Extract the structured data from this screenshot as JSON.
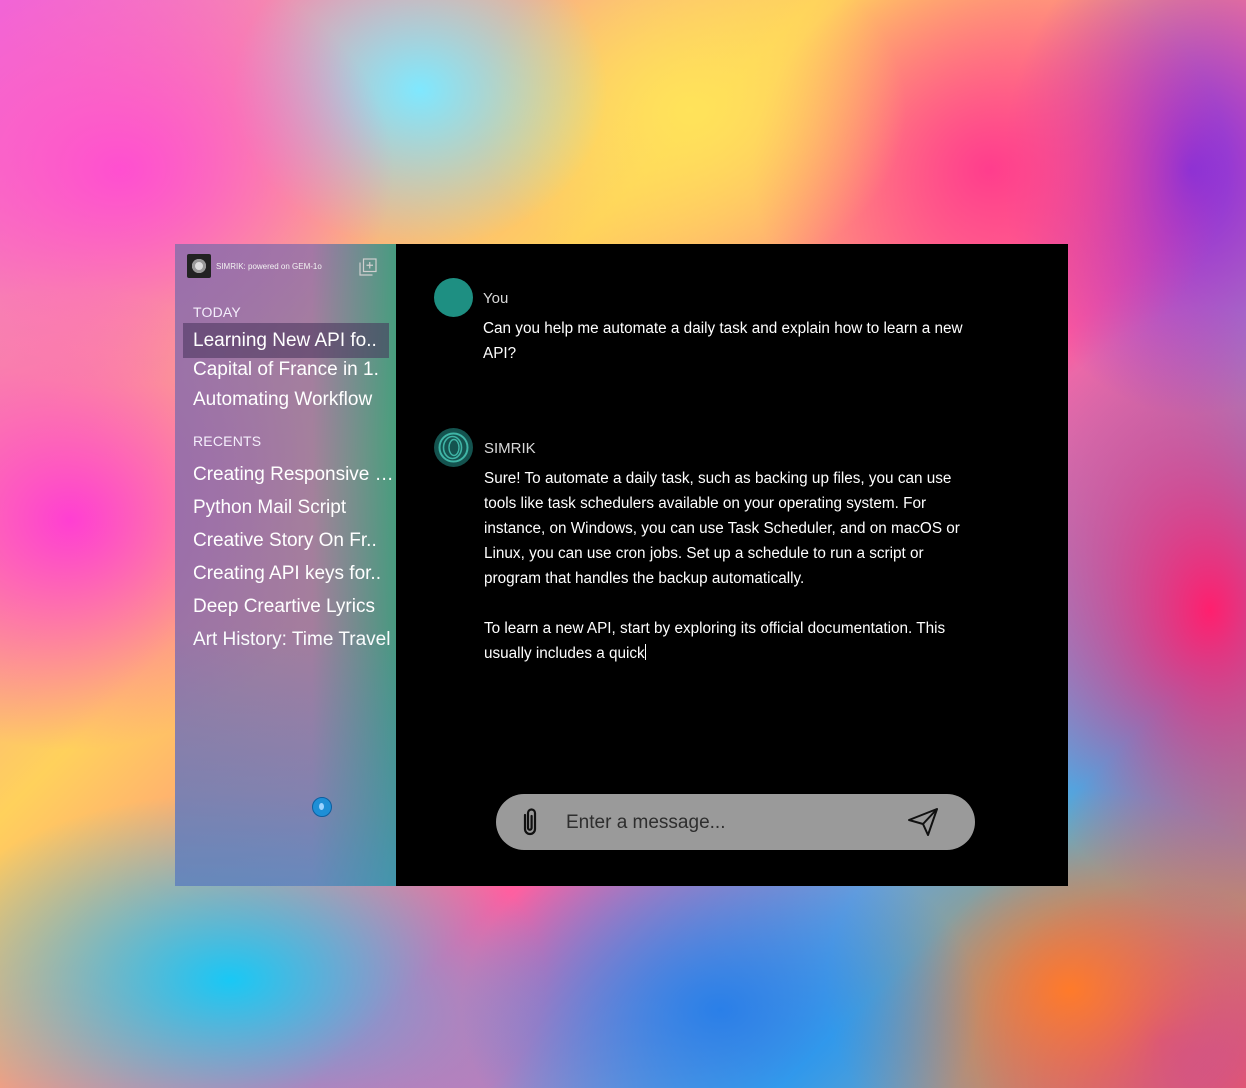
{
  "sidebar": {
    "brand_text": "SIMRIK: powered on GEM-1o",
    "today_label": "TODAY",
    "today_items": [
      {
        "label": "Learning New API fo.."
      },
      {
        "label": "Capital of France in 1."
      },
      {
        "label": "Automating Workflow"
      }
    ],
    "recents_label": "RECENTS",
    "recent_items": [
      {
        "label": "Creating Responsive Websites"
      },
      {
        "label": "Python Mail Script"
      },
      {
        "label": "Creative Story On Fr.."
      },
      {
        "label": "Creating API keys for.."
      },
      {
        "label": "Deep Creartive Lyrics"
      },
      {
        "label": "Art History: Time Travel"
      }
    ]
  },
  "conversation": {
    "user": {
      "name": "You",
      "text": "Can you help me automate a daily task and explain how to learn a new API?"
    },
    "bot": {
      "name": "SIMRIK",
      "paragraphs": [
        "Sure! To automate a daily task, such as backing up files, you can use tools like task schedulers available on your operating system. For instance, on Windows, you can use Task Scheduler, and on macOS or Linux, you can use cron jobs. Set up a schedule to run a script or program that handles the backup automatically.",
        "To learn a new API, start by exploring its official documentation. This usually includes a quick"
      ]
    }
  },
  "composer": {
    "placeholder": "Enter a message..."
  },
  "colors": {
    "main_bg": "#000000",
    "user_avatar": "#1e8f82",
    "bot_avatar": "#14534f",
    "composer_bg": "#9a9a9a"
  },
  "icons": {
    "brand": "simrik-logo-icon",
    "new_chat": "new-chat-icon",
    "attach": "paperclip-icon",
    "send": "send-icon"
  }
}
